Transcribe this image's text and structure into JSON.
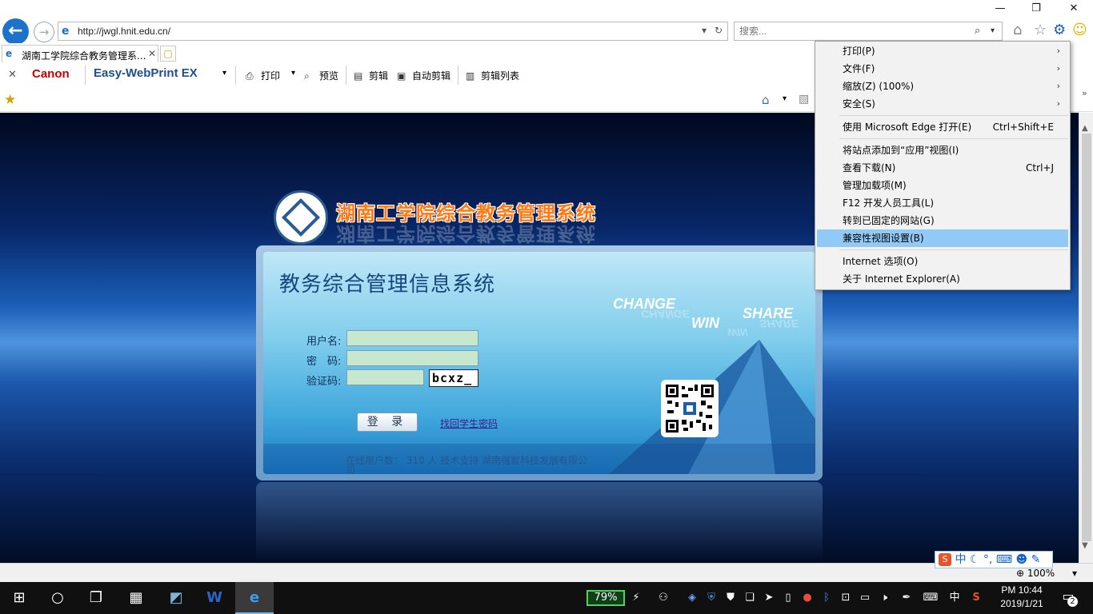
{
  "window": {
    "minimize_icon": "minimize-icon",
    "restore_label": "❐",
    "close_label": "✕",
    "min_label": "—"
  },
  "browser": {
    "url": "http://jwgl.hnit.edu.cn/",
    "search_placeholder": "搜索...",
    "tab_title": "湖南工学院综合教务管理系...",
    "tab_close": "✕"
  },
  "command_bar": {
    "canon": "Canon",
    "easy_webprint": "Easy-WebPrint EX",
    "print": "打印",
    "preview": "预览",
    "clip": "剪辑",
    "auto_clip": "自动剪辑",
    "clip_list": "剪辑列表"
  },
  "page": {
    "school_title": "湖南工学院综合教务管理系统",
    "system_title": "教务综合管理信息系统",
    "words": {
      "change": "CHANGE",
      "win": "WIN",
      "share": "SHARE"
    },
    "form": {
      "username_label": "用户名:",
      "password_label": "密　码:",
      "captcha_label": "验证码:",
      "username_value": "",
      "password_value": "",
      "captcha_value": "",
      "captcha_image_text": "bcxz_",
      "login_button": "登 录",
      "forgot_link": "找回学生密码"
    },
    "footer_line1": "在线用户数： 310 人    技术支持 湖南强智科技发展有限公",
    "footer_line2": "司"
  },
  "menu": {
    "items": [
      {
        "label": "打印(P)",
        "arrow": "›"
      },
      {
        "label": "文件(F)",
        "arrow": "›"
      },
      {
        "label": "缩放(Z) (100%)",
        "arrow": "›"
      },
      {
        "label": "安全(S)",
        "arrow": "›"
      },
      {
        "label": "使用 Microsoft Edge 打开(E)",
        "accel": "Ctrl+Shift+E"
      },
      {
        "label": "将站点添加到“应用”视图(I)"
      },
      {
        "label": "查看下载(N)",
        "accel": "Ctrl+J"
      },
      {
        "label": "管理加载项(M)"
      },
      {
        "label": "F12 开发人员工具(L)"
      },
      {
        "label": "转到已固定的网站(G)"
      },
      {
        "label": "兼容性视图设置(B)"
      },
      {
        "label": "Internet 选项(O)"
      },
      {
        "label": "关于 Internet Explorer(A)"
      }
    ],
    "highlighted_index": 10
  },
  "status": {
    "zoom": "100%",
    "ime_mode": "中"
  },
  "taskbar": {
    "battery": "79%",
    "ime": "中",
    "time": "PM 10:44",
    "date": "2019/1/21",
    "notifications": "2"
  },
  "colors": {
    "menu_highlight": "#91c9f7",
    "canon_red": "#cc0000",
    "title_orange": "#ff7a12",
    "battery_green": "#4ed160"
  }
}
